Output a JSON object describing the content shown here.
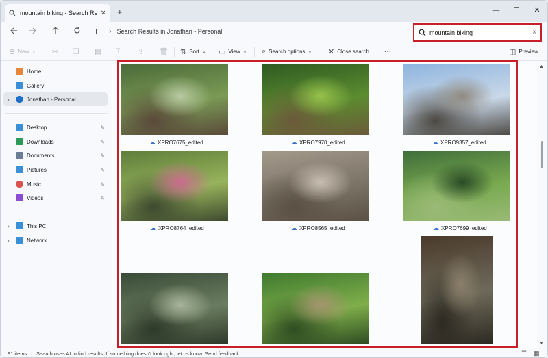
{
  "window": {
    "tab_title": "mountain biking - Search Res",
    "new_tab": "+",
    "minimize": "—",
    "maximize": "☐",
    "close": "✕"
  },
  "nav": {
    "back_icon": "arrow-left-icon",
    "forward_icon": "arrow-right-icon",
    "up_icon": "arrow-up-icon",
    "refresh_icon": "refresh-icon",
    "address_path": "Search Results in Jonathan - Personal",
    "search_value": "mountain biking",
    "search_clear": "×"
  },
  "toolbar": {
    "new_label": "New",
    "sort_label": "Sort",
    "view_label": "View",
    "search_options_label": "Search options",
    "close_search_label": "Close search",
    "more_label": "···",
    "preview_label": "Preview"
  },
  "sidebar": {
    "items": [
      {
        "label": "Home",
        "icon": "home-icon",
        "color": "#e6873b"
      },
      {
        "label": "Gallery",
        "icon": "gallery-icon",
        "color": "#3a8fd6"
      },
      {
        "label": "Jonathan - Personal",
        "icon": "onedrive-icon",
        "color": "#1f6fc8"
      },
      {
        "label": "Desktop",
        "icon": "desktop-icon",
        "color": "#3a8fd6"
      },
      {
        "label": "Downloads",
        "icon": "downloads-icon",
        "color": "#2e9a58"
      },
      {
        "label": "Documents",
        "icon": "documents-icon",
        "color": "#6a7d95"
      },
      {
        "label": "Pictures",
        "icon": "pictures-icon",
        "color": "#3a8fd6"
      },
      {
        "label": "Music",
        "icon": "music-icon",
        "color": "#d9534f"
      },
      {
        "label": "Videos",
        "icon": "videos-icon",
        "color": "#8a4fd1"
      },
      {
        "label": "This PC",
        "icon": "pc-icon",
        "color": "#3a8fd6"
      },
      {
        "label": "Network",
        "icon": "network-icon",
        "color": "#3a8fd6"
      }
    ]
  },
  "results": {
    "files": [
      {
        "name": "XPRO7675_edited",
        "palette": [
          "#4b6b3a",
          "#7a9a55",
          "#b7c9a0",
          "#5a4a3a"
        ]
      },
      {
        "name": "XPRO7970_edited",
        "palette": [
          "#2f5a22",
          "#5c8c2f",
          "#96c24b",
          "#6b5a3a"
        ]
      },
      {
        "name": "XPRO9357_edited",
        "palette": [
          "#8fb5df",
          "#c9d8e8",
          "#8f8a80",
          "#4d4a45"
        ]
      },
      {
        "name": "XPRO8764_edited",
        "palette": [
          "#5e7d3a",
          "#97b35b",
          "#c96b8e",
          "#3e4a2f"
        ]
      },
      {
        "name": "XPRO8565_edited",
        "palette": [
          "#a39a8c",
          "#7d7468",
          "#c8bfb2",
          "#5a5044"
        ]
      },
      {
        "name": "XPRO7699_edited",
        "palette": [
          "#3f6e3a",
          "#78a94f",
          "#2a4a26",
          "#9aba77"
        ]
      },
      {
        "name": "",
        "palette": [
          "#4a3a2c",
          "#6e6a5a",
          "#8b7f6a",
          "#2d2a22"
        ]
      },
      {
        "name": "",
        "palette": [
          "#3a4a38",
          "#6a7d60",
          "#a7b49a",
          "#2e3a2a"
        ]
      },
      {
        "name": "",
        "palette": [
          "#3f7a2f",
          "#7fae4a",
          "#a4946e",
          "#2f4d22"
        ]
      }
    ]
  },
  "status": {
    "item_count": "91 items",
    "message": "Search uses AI to find results. If something doesn't look right, let us know.  Send feedback."
  }
}
